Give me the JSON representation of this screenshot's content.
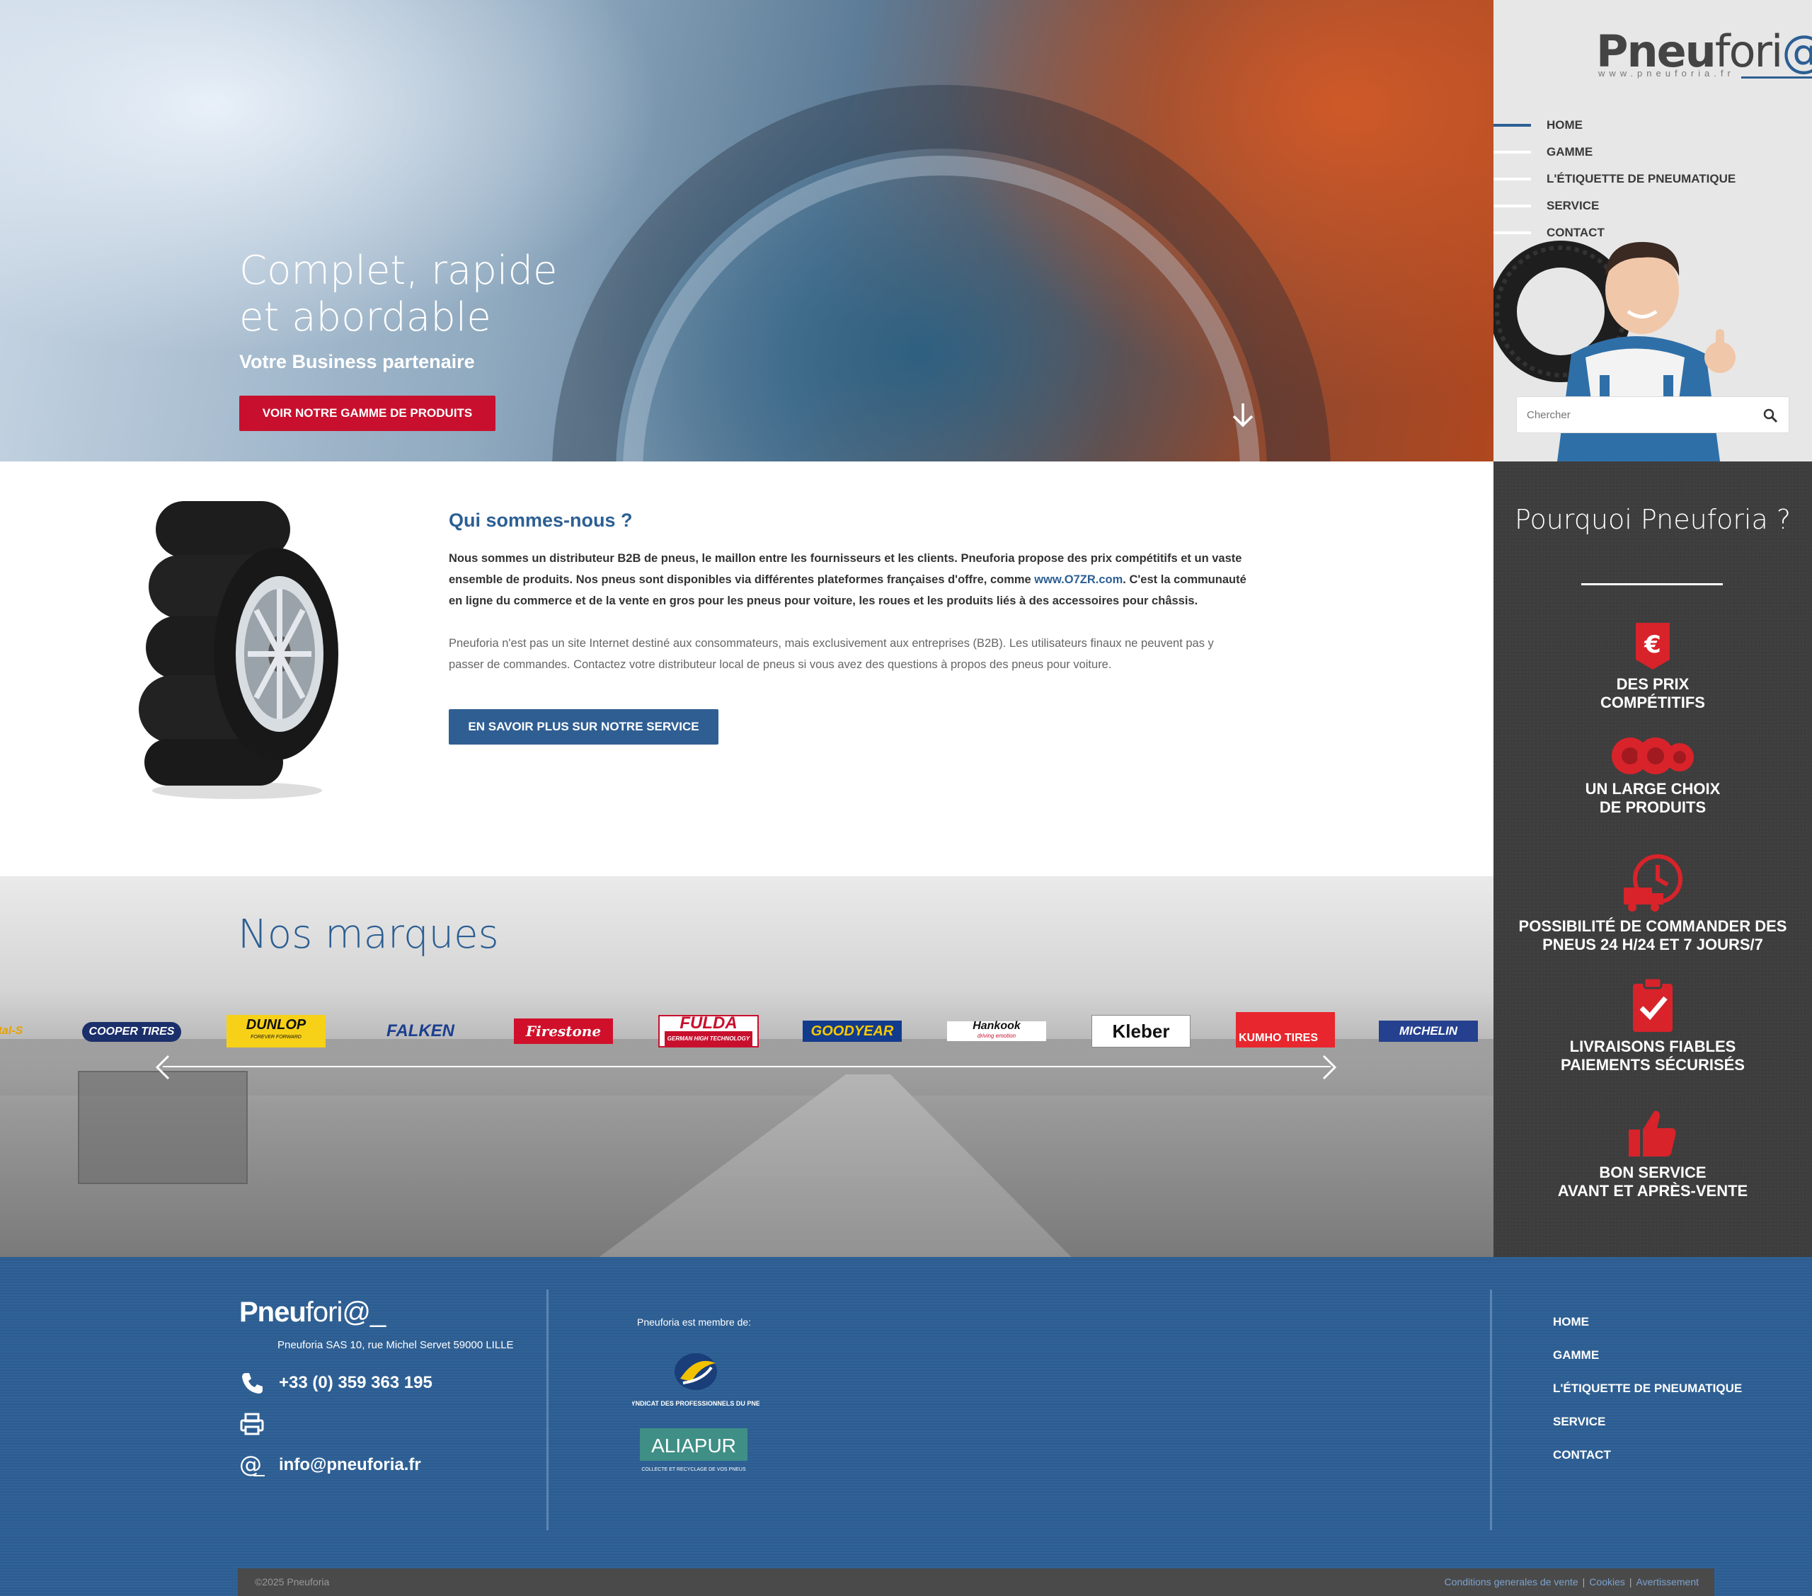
{
  "hero": {
    "title": "Complet, rapide et abordable",
    "subtitle": "Votre Business partenaire",
    "cta": "VOIR NOTRE GAMME DE PRODUITS"
  },
  "brand": {
    "logo_main": "Pneu",
    "logo_light": "fori",
    "logo_at": "@",
    "logo_url": "www.pneuforia.fr"
  },
  "nav": {
    "items": [
      {
        "label": "HOME",
        "active": true
      },
      {
        "label": "GAMME",
        "active": false
      },
      {
        "label": "L'ÉTIQUETTE DE PNEUMATIQUE",
        "active": false
      },
      {
        "label": "SERVICE",
        "active": false
      },
      {
        "label": "CONTACT",
        "active": false
      }
    ]
  },
  "search": {
    "placeholder": "Chercher"
  },
  "why": {
    "title": "Pourquoi Pneuforia ?",
    "features": [
      {
        "icon": "euro-tag-icon",
        "line1": "DES PRIX",
        "line2": "COMPÉTITIFS"
      },
      {
        "icon": "tyres-icon",
        "line1": "UN LARGE CHOIX",
        "line2": "DE PRODUITS"
      },
      {
        "icon": "delivery-clock-icon",
        "line1": "POSSIBILITÉ DE COMMANDER DES",
        "line2": "PNEUS 24 H/24 ET 7 JOURS/7"
      },
      {
        "icon": "clipboard-check-icon",
        "line1": "LIVRAISONS FIABLES",
        "line2": "PAIEMENTS SÉCURISÉS"
      },
      {
        "icon": "thumbs-up-icon",
        "line1": "BON SERVICE",
        "line2": "AVANT ET APRÈS-VENTE"
      }
    ],
    "accent": "#d8232a"
  },
  "about": {
    "title": "Qui sommes-nous ?",
    "p1_a": "Nous sommes un distributeur B2B de pneus, le maillon entre les fournisseurs et les clients. Pneuforia propose des prix compétitifs et un vaste ensemble de produits. Nos pneus sont disponibles via différentes plateformes françaises d'offre, comme ",
    "p1_link": "www.O7ZR.com",
    "p1_b": ". C'est la communauté en ligne du commerce et de la vente en gros pour les pneus pour voiture, les roues et les produits liés à des accessoires pour châssis.",
    "p2": "Pneuforia n'est pas un site Internet destiné aux consommateurs, mais exclusivement aux entreprises (B2B). Les utilisateurs finaux ne peuvent pas y passer de commandes. Contactez votre distributeur local de pneus si vous avez des questions à propos des pneus pour voiture.",
    "cta": "EN SAVOIR PLUS SUR NOTRE SERVICE"
  },
  "brands": {
    "title": "Nos marques",
    "logos": [
      "tal-S",
      "COOPER TIRES",
      "DUNLOP",
      "FALKEN",
      "Firestone",
      "FULDA",
      "GOODYEAR",
      "Hankook",
      "Kleber",
      "KUMHO TIRES",
      "MICHELIN"
    ],
    "dunlop_tag": "FOREVER FORWARD",
    "fulda_tag": "GERMAN HIGH TECHNOLOGY",
    "hankook_tag": "driving emotion"
  },
  "footer": {
    "logo_main": "Pneu",
    "logo_light": "fori@_",
    "address": "Pneuforia SAS 10, rue Michel Servet 59000 LILLE",
    "phone": "+33 (0) 359 363 195",
    "fax": "",
    "email": "info@pneuforia.fr",
    "member_label": "Pneuforia est membre de:",
    "spp_label": "SYNDICAT DES PROFESSIONNELS DU PNEU",
    "aliapur_label": "ALIAPUR",
    "aliapur_tag": "COLLECTE ET RECYCLAGE DE VOS PNEUS",
    "nav": [
      "HOME",
      "GAMME",
      "L'ÉTIQUETTE DE PNEUMATIQUE",
      "SERVICE",
      "CONTACT"
    ],
    "copyright": "©2025 Pneuforia",
    "links": [
      "Conditions generales de vente",
      "Cookies",
      "Avertissement"
    ]
  }
}
